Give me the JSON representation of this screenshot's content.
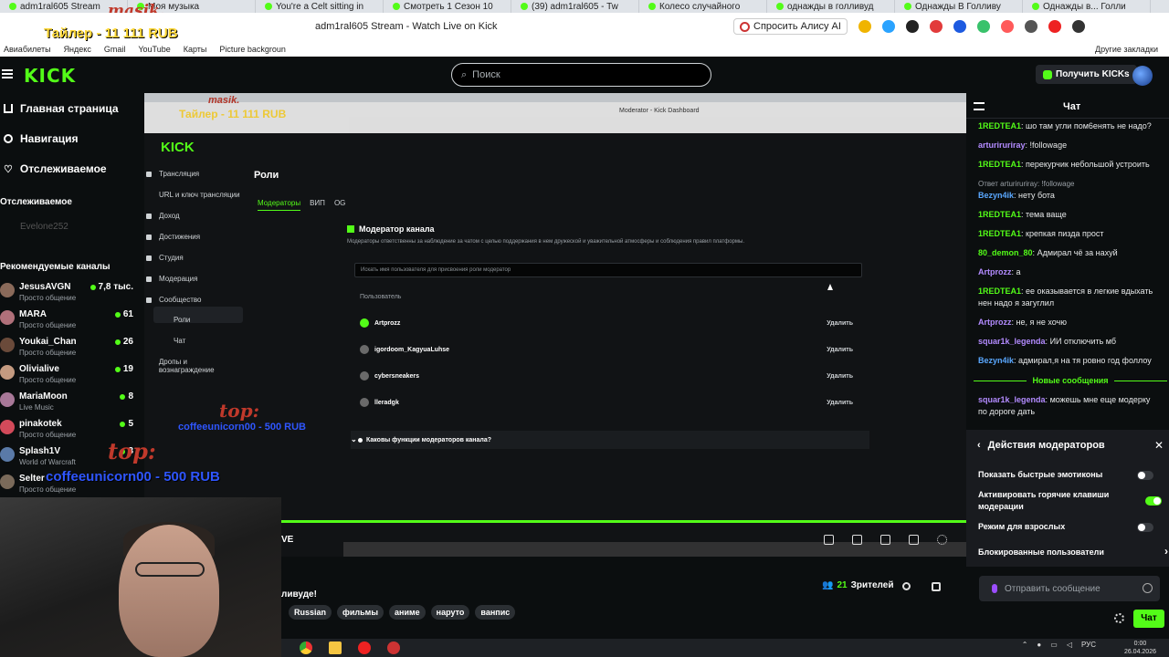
{
  "browser": {
    "tabs": [
      "adm1ral605 Stream",
      "Моя музыка",
      "You're a Celt sitting in",
      "Смотреть 1 Сезон 10",
      "(39) adm1ral605 - Tw",
      "Колесо случайного",
      "однажды в голливуд",
      "Однажды В Голливу",
      "Однажды в... Голли"
    ],
    "title": "adm1ral605 Stream - Watch Live on Kick",
    "alisa": "Спросить Алису AI",
    "bookmarks": [
      "Авиабилеты",
      "Яндекс",
      "Gmail",
      "YouTube",
      "Карты",
      "Picture backgroun"
    ],
    "other_bookmarks": "Другие закладки"
  },
  "overlay": {
    "tailer": "Тайлер - 11 111 RUB",
    "masik": "masik."
  },
  "header": {
    "search_placeholder": "Поиск",
    "get_kicks": "Получить KICKs",
    "logo": "KICK"
  },
  "sidebar": {
    "nav": [
      "Главная страница",
      "Навигация",
      "Отслеживаемое"
    ],
    "followed_title": "Отслеживаемое",
    "followed_user": "Evelone252",
    "recommended_title": "Рекомендуемые каналы",
    "channels": [
      {
        "name": "JesusAVGN",
        "cat": "Просто общение",
        "viewers": "7,8 тыс."
      },
      {
        "name": "MARA",
        "cat": "Просто общение",
        "viewers": "61"
      },
      {
        "name": "Youkai_Chan",
        "cat": "Просто общение",
        "viewers": "26"
      },
      {
        "name": "Olivialive",
        "cat": "Просто общение",
        "viewers": "19"
      },
      {
        "name": "MariaMoon",
        "cat": "Live Music",
        "viewers": "8"
      },
      {
        "name": "pinakotek",
        "cat": "Просто общение",
        "viewers": "5"
      },
      {
        "name": "Splash1V",
        "cat": "World of Warcraft",
        "viewers": "3"
      },
      {
        "name": "Selter",
        "cat": "Просто общение",
        "viewers": ""
      }
    ]
  },
  "video": {
    "inner_url": "Moderator - Kick Dashboard",
    "dash_menu": [
      "Трансляция",
      "URL и ключ трансляции",
      "Доход",
      "Достижения",
      "Студия",
      "Модерация",
      "Сообщество",
      "Роли",
      "Чат",
      "Дропы и вознаграждение"
    ],
    "roles_title": "Роли",
    "role_tabs": [
      "Модераторы",
      "ВИП",
      "OG"
    ],
    "mod_title": "Модератор канала",
    "mod_desc": "Модераторы ответственны за наблюдение за чатом с целью поддержания в нем дружеской и уважительной атмосферы и соблюдения правил платформы.",
    "mod_search": "Искать имя пользователя для присвоения роли модератор",
    "mod_column": "Пользователь",
    "mods": [
      "Artprozz",
      "igordoom_KagyuaLuhse",
      "cybersneakers",
      "lleradgk"
    ],
    "remove": "Удалить",
    "faq": "Каковы функции модераторов канала?"
  },
  "donations": {
    "top1": "top:",
    "msg1": "coffeeunicorn00 - 500 RUB",
    "top2": "top:",
    "msg2": "coffeeunicorn00 - 500 RUB"
  },
  "stream": {
    "live": "VE",
    "title_partial": "ливуде!",
    "tags": [
      "Russian",
      "фильмы",
      "аниме",
      "наруто",
      "ванпис"
    ],
    "viewers": "21",
    "viewers_label": "Зрителей"
  },
  "taskbar": {
    "lang": "РУС",
    "time": "0:00",
    "date": "26.04.2026"
  },
  "chat": {
    "title": "Чат",
    "messages": [
      {
        "user": "1REDTEA1",
        "color": "#53fc18",
        "text": "шо там угли пом6енять не надо?"
      },
      {
        "user": "arturiruriray",
        "color": "#b38bff",
        "text": "!followage"
      },
      {
        "user": "1REDTEA1",
        "color": "#53fc18",
        "text": "перекурчик небольшой устроить"
      },
      {
        "reply": "Ответ arturiruriray: !followage",
        "user": "Bezyn4ik",
        "color": "#5aa8ff",
        "text": "нету бота"
      },
      {
        "user": "1REDTEA1",
        "color": "#53fc18",
        "text": "тема ваще"
      },
      {
        "user": "1REDTEA1",
        "color": "#53fc18",
        "text": "крепкая пизда прост"
      },
      {
        "user": "80_demon_80",
        "color": "#53fc18",
        "text": "Адмирал чё за нахуй"
      },
      {
        "user": "Artprozz",
        "color": "#b38bff",
        "text": "а"
      },
      {
        "user": "1REDTEA1",
        "color": "#53fc18",
        "text": "ее оказывается в легкие вдыхать нен надо я загуглил"
      },
      {
        "user": "Artprozz",
        "color": "#b38bff",
        "text": "не, я не хочю"
      },
      {
        "user": "squar1k_legenda",
        "color": "#b38bff",
        "text": "ИИ отключить мб"
      },
      {
        "user": "Bezyn4ik",
        "color": "#5aa8ff",
        "text": "адмирал,я на тя ровно год фоллоу"
      }
    ],
    "new_messages": "Новые сообщения",
    "after_new": {
      "user": "squar1k_legenda",
      "color": "#b38bff",
      "text": "можешь мне еще модерку по дороге дать"
    },
    "mod_panel": {
      "title": "Действия модераторов",
      "rows": [
        {
          "label": "Показать быстрые эмотиконы",
          "on": false
        },
        {
          "label": "Активировать горячие клавиши модерации",
          "on": true
        },
        {
          "label": "Режим для взрослых",
          "on": false
        }
      ],
      "blocked": "Блокированные пользователи"
    },
    "input_placeholder": "Отправить сообщение",
    "send": "Чат"
  }
}
